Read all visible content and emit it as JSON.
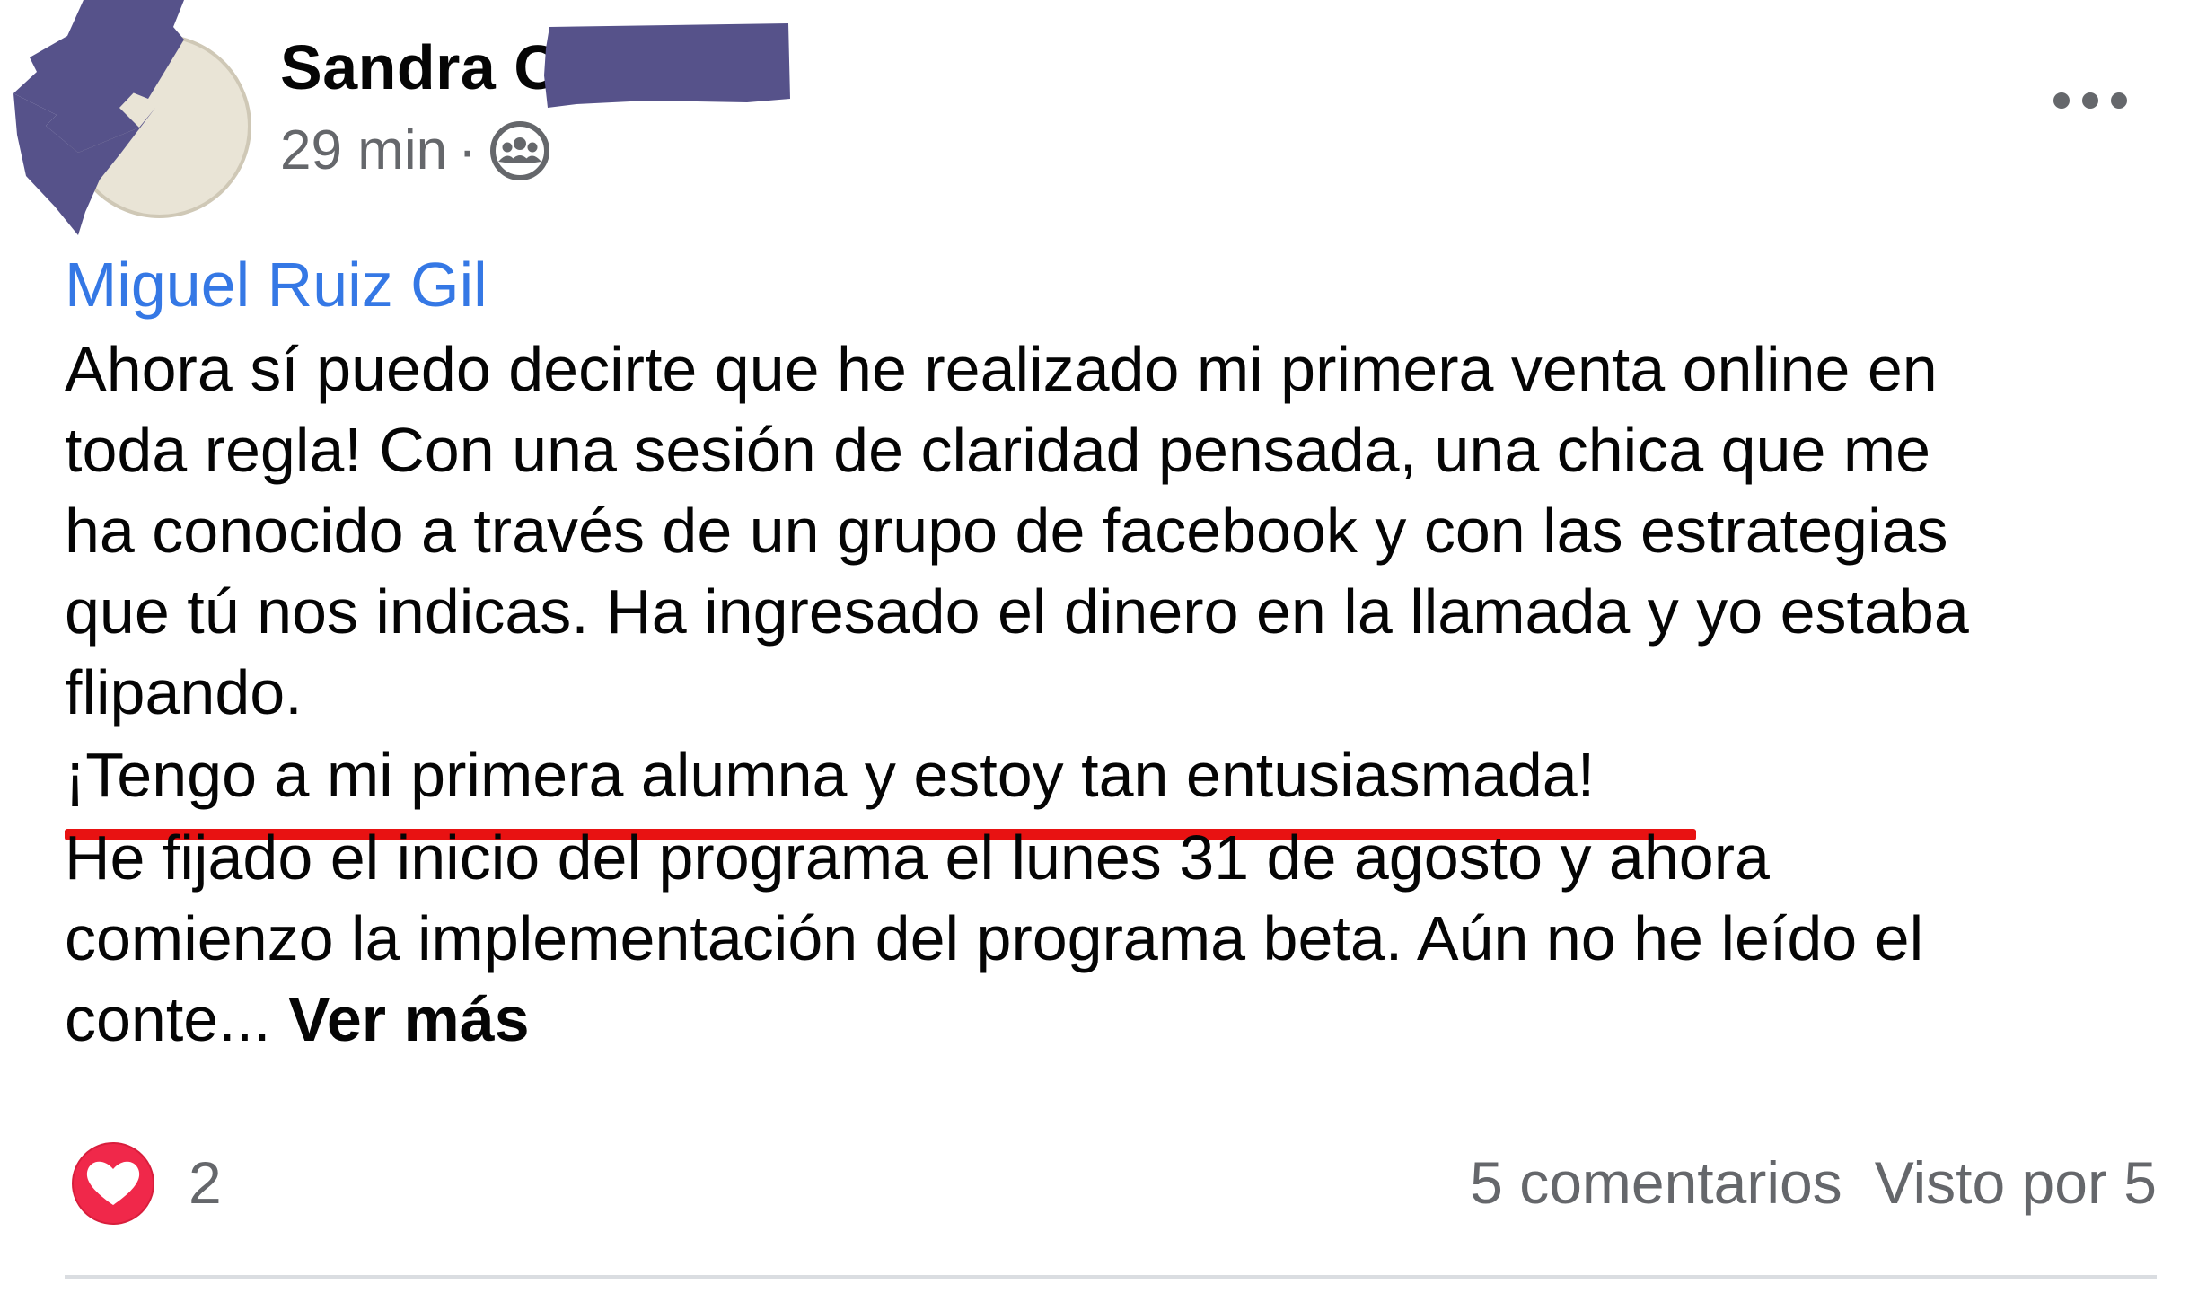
{
  "post": {
    "author_name": "Sandra C",
    "time": "29 min",
    "separator": "·",
    "privacy_icon": "group-members-icon",
    "more_icon": "ellipsis-icon",
    "mention": "Miguel Ruiz Gil",
    "body_lines": [
      "Ahora sí puedo decirte que he realizado mi primera venta online en",
      "toda regla! Con una sesión de claridad pensada, una chica que me",
      "ha conocido a través de un grupo de facebook y con las estrategias",
      "que tú nos indicas. Ha ingresado el dinero en la llamada y yo estaba",
      "flipando.",
      "¡Tengo a mi primera alumna y estoy tan entusiasmada!",
      "He fijado el inicio del programa el lunes 31 de agosto y ahora",
      "comienzo la implementación del programa beta. Aún no he leído el"
    ],
    "truncated_line": "conte...",
    "see_more": "Ver más"
  },
  "footer": {
    "reaction_icon": "heart-love-icon",
    "reaction_count": "2",
    "comments": "5 comentarios",
    "seen_by": "Visto por 5"
  },
  "colors": {
    "link": "#3578e5",
    "muted": "#65676b",
    "highlight_underline": "#e81212",
    "redaction": "#56528a",
    "heart": "#f0284a"
  }
}
